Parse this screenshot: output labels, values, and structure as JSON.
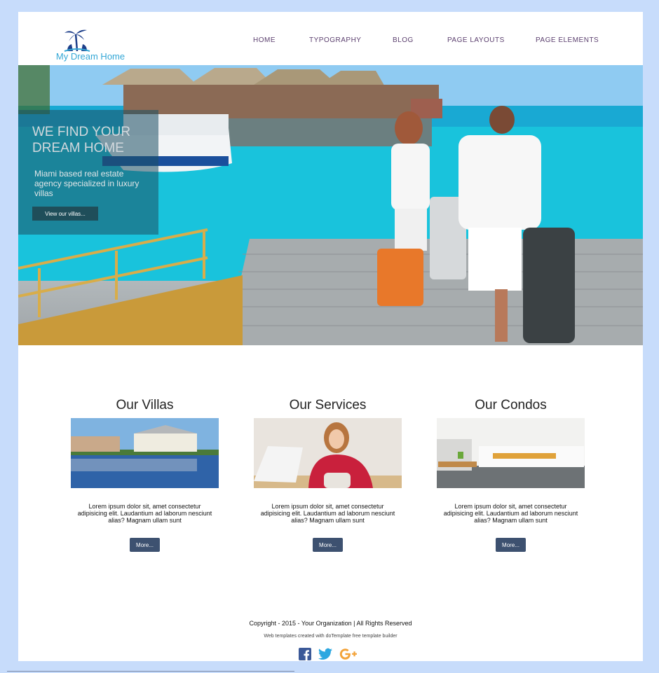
{
  "header": {
    "logo_text": "My Dream Home",
    "nav": [
      {
        "label": "HOME"
      },
      {
        "label": "TYPOGRAPHY"
      },
      {
        "label": "BLOG"
      },
      {
        "label": "PAGE LAYOUTS"
      },
      {
        "label": "PAGE ELEMENTS"
      }
    ]
  },
  "hero": {
    "title": "WE FIND YOUR DREAM HOME",
    "subtitle": "Miami based real estate agency specialized in luxury villas",
    "button_label": "View our villas..."
  },
  "columns": [
    {
      "title": "Our Villas",
      "text": "Lorem ipsum dolor sit, amet consectetur adipisicing elit. Laudantium ad laborum nesciunt alias? Magnam ullam sunt",
      "button_label": "More..."
    },
    {
      "title": "Our Services",
      "text": "Lorem ipsum dolor sit, amet consectetur adipisicing elit. Laudantium ad laborum nesciunt alias? Magnam ullam sunt",
      "button_label": "More..."
    },
    {
      "title": "Our Condos",
      "text": "Lorem ipsum dolor sit, amet consectetur adipisicing elit. Laudantium ad laborum nesciunt alias? Magnam ullam sunt",
      "button_label": "More..."
    }
  ],
  "footer": {
    "copyright": "Copyright - 2015 - Your Organization | All Rights Reserved",
    "credits": "Web templates created with doTemplate free template builder",
    "social": [
      {
        "icon": "facebook-icon",
        "color": "#3b5998"
      },
      {
        "icon": "twitter-icon",
        "color": "#2ca7e0"
      },
      {
        "icon": "google-plus-icon",
        "color": "#f3a33a"
      }
    ]
  },
  "colors": {
    "background": "#c7dcfb",
    "nav_text": "#5b3f6e",
    "logo": "#34a7d6",
    "button": "#3d5170"
  }
}
